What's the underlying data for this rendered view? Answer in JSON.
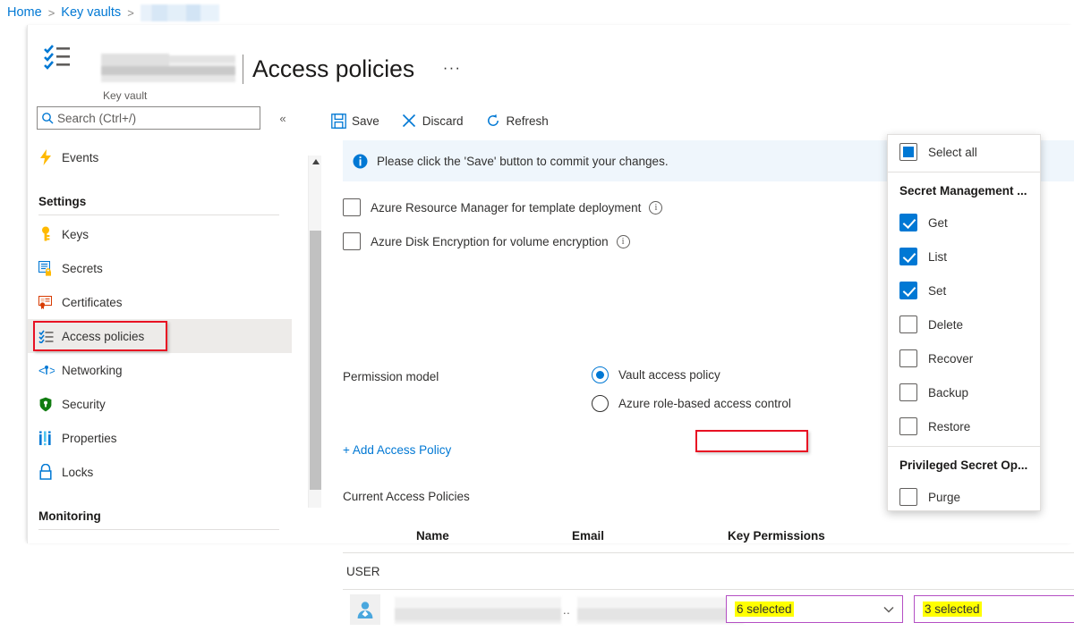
{
  "breadcrumb": {
    "items": [
      "Home",
      "Key vaults"
    ],
    "separator": ">",
    "redacted_last": true
  },
  "header": {
    "title": "Access policies",
    "subtitle": "Key vault",
    "more_menu": "···",
    "divider": "|"
  },
  "sidebar": {
    "search_placeholder": "Search (Ctrl+/)",
    "search_value": "",
    "collapse_label": "«",
    "items": [
      {
        "label": "Events",
        "icon": "events-icon",
        "selected": false
      },
      {
        "label": "Settings",
        "type": "group"
      },
      {
        "label": "Keys",
        "icon": "key-icon",
        "selected": false
      },
      {
        "label": "Secrets",
        "icon": "secrets-icon",
        "selected": false
      },
      {
        "label": "Certificates",
        "icon": "certificate-icon",
        "selected": false
      },
      {
        "label": "Access policies",
        "icon": "access-policies-icon",
        "selected": true
      },
      {
        "label": "Networking",
        "icon": "networking-icon",
        "selected": false
      },
      {
        "label": "Security",
        "icon": "security-shield-icon",
        "selected": false
      },
      {
        "label": "Properties",
        "icon": "properties-icon",
        "selected": false
      },
      {
        "label": "Locks",
        "icon": "lock-icon",
        "selected": false
      },
      {
        "label": "Monitoring",
        "type": "group"
      }
    ]
  },
  "toolbar": {
    "save_label": "Save",
    "discard_label": "Discard",
    "refresh_label": "Refresh"
  },
  "banner": {
    "text": "Please click the 'Save' button to commit your changes.",
    "icon": "info-icon",
    "background": "#eff6fc"
  },
  "options": {
    "arm_label": "Azure Resource Manager for template deployment",
    "arm_checked": false,
    "ade_label": "Azure Disk Encryption for volume encryption",
    "ade_checked": false,
    "info_glyph": "i"
  },
  "permission_model": {
    "label": "Permission model",
    "options": [
      {
        "label": "Vault access policy",
        "selected": true
      },
      {
        "label": "Azure role-based access control",
        "selected": false
      }
    ]
  },
  "add_policy_label": "+ Add Access Policy",
  "table": {
    "caption": "Current Access Policies",
    "columns": [
      "Name",
      "Email",
      "Key Permissions"
    ],
    "group_label": "USER",
    "rows": [
      {
        "avatar": "user-avatar-icon",
        "name": "",
        "name_overflow": "..",
        "email": "",
        "email_overflow": "..",
        "key_permissions": "6 selected",
        "secret_permissions": "3 selected"
      }
    ]
  },
  "permissions_flyout": {
    "select_all_label": "Select all",
    "select_all_state": "indeterminate",
    "groups": [
      {
        "title": "Secret Management ...",
        "items": [
          {
            "label": "Get",
            "checked": true
          },
          {
            "label": "List",
            "checked": true
          },
          {
            "label": "Set",
            "checked": true
          },
          {
            "label": "Delete",
            "checked": false
          },
          {
            "label": "Recover",
            "checked": false
          },
          {
            "label": "Backup",
            "checked": false
          },
          {
            "label": "Restore",
            "checked": false
          }
        ]
      },
      {
        "title": "Privileged Secret Op...",
        "items": [
          {
            "label": "Purge",
            "checked": false
          }
        ]
      }
    ]
  },
  "colors": {
    "accent": "#0078d4",
    "highlight_box": "#e81123",
    "highlight_text_bg": "#ffff00",
    "dropdown_border": "#b44fc4",
    "banner_bg": "#eff6fc",
    "selected_nav_bg": "#edebe9"
  }
}
